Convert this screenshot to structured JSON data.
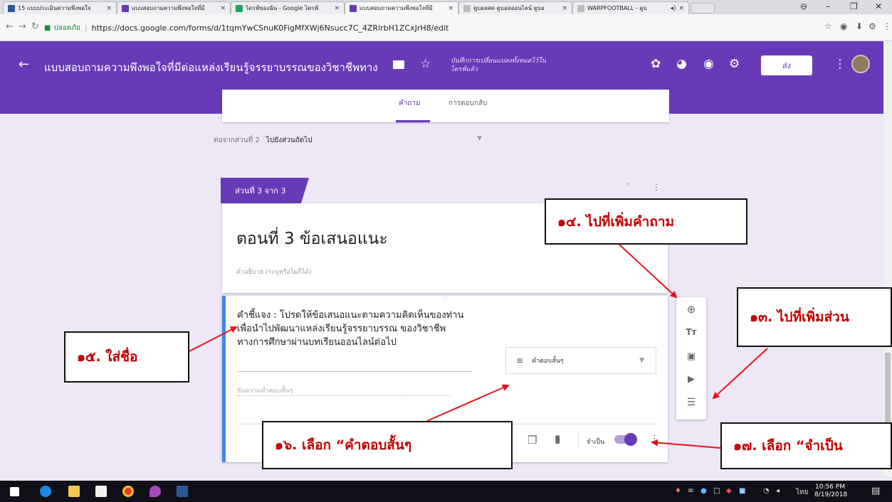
{
  "browser": {
    "tabs": [
      {
        "label": "15 แบบประเมินความพึงพอใจ",
        "color": "#2b579a"
      },
      {
        "label": "แบบสอบถามความพึงพอใจที่มี",
        "color": "#673ab7"
      },
      {
        "label": "ไดรฟ์ของฉัน - Google ไดรฟ์",
        "color": "#1fa463"
      },
      {
        "label": "แบบสอบถามความพึงพอใจที่มี",
        "color": "#673ab7"
      },
      {
        "label": "ดูบอลสด ดูบอลออนไลน์ ดูบอ",
        "color": "#9e9e9e"
      },
      {
        "label": "WARPFOOTBALL - ดูบ",
        "color": "#9e9e9e"
      }
    ],
    "tab_close": "×",
    "audio_icon": "◂)",
    "secure_label": "ปลอดภัย",
    "url": "https://docs.google.com/forms/d/1tqmYwCSnuK0FigMfXWj6Nsucc7C_4ZRlrbH1ZCxJrH8/edit"
  },
  "form_header": {
    "title": "แบบสอบถามความพึงพอใจที่มีต่อแหล่งเรียนรู้จรรยาบรรณของวิชาชีพทาง",
    "saved_status": "บันทึกการเปลี่ยนแปลงทั้งหมดไว้ในไดรฟ์แล้ว",
    "send_label": "ส่ง",
    "tabs": {
      "questions": "คำถาม",
      "responses": "การตอบกลับ"
    }
  },
  "after_section": {
    "label": "ต่อจากส่วนที่ 2",
    "value": "ไปยังส่วนถัดไป"
  },
  "section": {
    "badge": "ส่วนที่ 3 จาก 3",
    "title": "ตอนที่ 3 ข้อเสนอแนะ",
    "description_placeholder": "คำอธิบาย (ระบุหรือไม่ก็ได้)"
  },
  "question": {
    "title": "คำชี้แจง : โปรดให้ข้อเสนอแนะตามความคิดเห็นของท่านเพื่อนำไปพัฒนาแหล่งเรียนรู้จรรยาบรรณ ของวิชาชีพทางการศึกษาผ่านบทเรียนออนไลน์ต่อไป",
    "type": "คำตอบสั้นๆ",
    "answer_placeholder": "ข้อความคำตอบสั้นๆ",
    "required_label": "จำเป็น",
    "required": true
  },
  "annotations": {
    "n14": "๑๔. ไปที่เพิ่มคำถาม",
    "n13": "๑๓. ไปที่เพิ่มส่วน",
    "n15": "๑๕. ใส่ชื่อ",
    "n16": "๑๖. เลือก “คำตอบสั้นๆ",
    "n17": "๑๗. เลือก “จำเป็น"
  },
  "taskbar": {
    "language": "ไทย",
    "time": "10:56 PM",
    "date": "8/19/2018"
  },
  "colors": {
    "accent": "#673ab7",
    "annotation_text": "#c00000",
    "annotation_arrow": "#e8141b"
  }
}
